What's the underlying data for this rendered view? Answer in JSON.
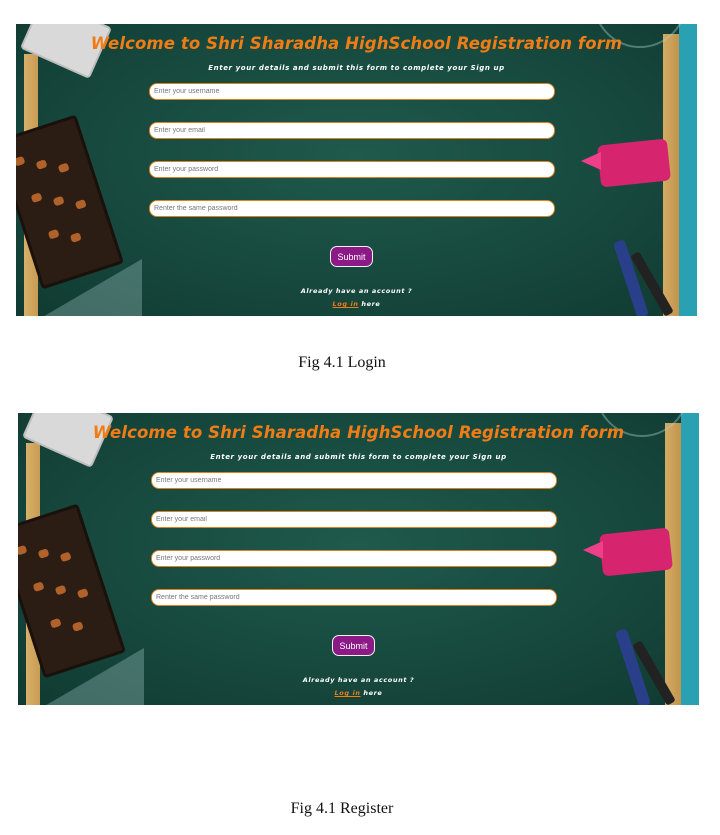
{
  "form": {
    "title": "Welcome to Shri Sharadha HighSchool Registration form",
    "subtitle": "Enter your details and submit this form to complete your Sign up",
    "username_placeholder": "Enter your username",
    "email_placeholder": "Enter your email",
    "password_placeholder": "Enter your password",
    "confirm_placeholder": "Renter the same password",
    "submit_label": "Submit",
    "already_text": "Already have an account ?",
    "login_link": "Log in",
    "here_text": " here"
  },
  "captions": {
    "first": "Fig 4.1 Login",
    "second": "Fig 4.1 Register"
  },
  "colors": {
    "title": "#f07c16",
    "field_border": "#e0821c",
    "submit_bg": "#8b1a86",
    "background": "#17493e"
  }
}
